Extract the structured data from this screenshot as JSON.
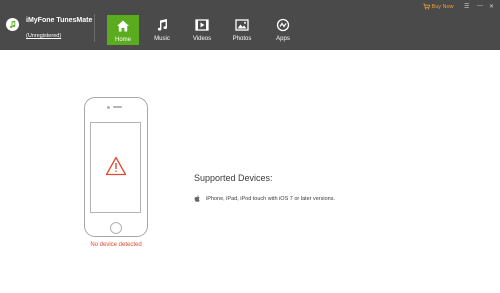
{
  "app": {
    "name": "iMyFone TunesMate",
    "registration_status": "(Unregistered)"
  },
  "tabs": [
    {
      "label": "Home",
      "icon": "home-icon",
      "active": true
    },
    {
      "label": "Music",
      "icon": "music-icon",
      "active": false
    },
    {
      "label": "Videos",
      "icon": "video-icon",
      "active": false
    },
    {
      "label": "Photos",
      "icon": "photo-icon",
      "active": false
    },
    {
      "label": "Apps",
      "icon": "apps-icon",
      "active": false
    }
  ],
  "header": {
    "buy_now_label": "Buy Now",
    "buy_now_icon": "cart-icon",
    "window_controls": [
      "menu-icon",
      "minimize-icon",
      "close-icon"
    ]
  },
  "device": {
    "status": "No device detected",
    "status_icon": "warning-icon"
  },
  "supported": {
    "title": "Supported Devices:",
    "icon": "apple-icon",
    "description": "iPhone, iPad, iPod touch with iOS 7 or later versions."
  },
  "colors": {
    "titlebar": "#4a4a4a",
    "active_tab": "#5aab1e",
    "buy_now": "#f0a030",
    "warning": "#e24a2f"
  }
}
